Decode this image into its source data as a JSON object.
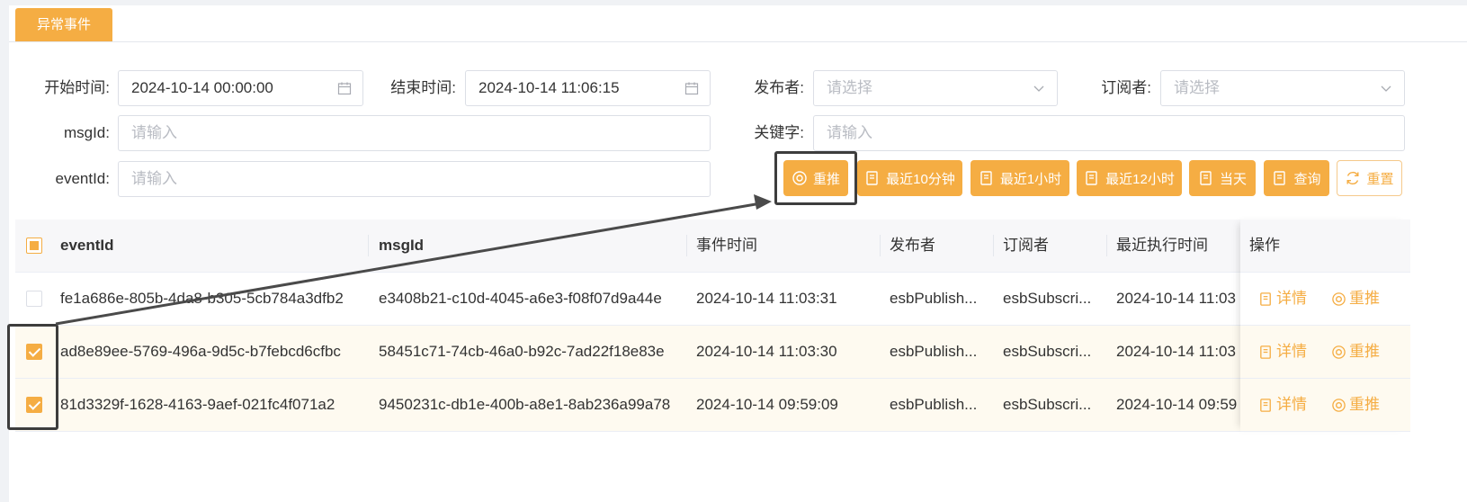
{
  "tab": {
    "label": "异常事件"
  },
  "filters": {
    "start_label": "开始时间:",
    "start_value": "2024-10-14 00:00:00",
    "end_label": "结束时间:",
    "end_value": "2024-10-14 11:06:15",
    "publisher_label": "发布者:",
    "publisher_placeholder": "请选择",
    "subscriber_label": "订阅者:",
    "subscriber_placeholder": "请选择",
    "msgid_label": "msgId:",
    "msgid_placeholder": "请输入",
    "keyword_label": "关键字:",
    "keyword_placeholder": "请输入",
    "eventid_label": "eventId:",
    "eventid_placeholder": "请输入"
  },
  "buttons": {
    "repush": "重推",
    "last10min": "最近10分钟",
    "last1h": "最近1小时",
    "last12h": "最近12小时",
    "today": "当天",
    "query": "查询",
    "reset": "重置"
  },
  "table": {
    "headers": {
      "eventId": "eventId",
      "msgId": "msgId",
      "event_time": "事件时间",
      "publisher": "发布者",
      "subscriber": "订阅者",
      "last_exec": "最近执行时间",
      "ops": "操作"
    },
    "rows": [
      {
        "checked": false,
        "eventId": "fe1a686e-805b-4da8-b305-5cb784a3dfb2",
        "msgId": "e3408b21-c10d-4045-a6e3-f08f07d9a44e",
        "event_time": "2024-10-14 11:03:31",
        "publisher": "esbPublish...",
        "subscriber": "esbSubscri...",
        "last_exec": "2024-10-14 11:03"
      },
      {
        "checked": true,
        "eventId": "ad8e89ee-5769-496a-9d5c-b7febcd6cfbc",
        "msgId": "58451c71-74cb-46a0-b92c-7ad22f18e83e",
        "event_time": "2024-10-14 11:03:30",
        "publisher": "esbPublish...",
        "subscriber": "esbSubscri...",
        "last_exec": "2024-10-14 11:03"
      },
      {
        "checked": true,
        "eventId": "81d3329f-1628-4163-9aef-021fc4f071a2",
        "msgId": "9450231c-db1e-400b-a8e1-8ab236a99a78",
        "event_time": "2024-10-14 09:59:09",
        "publisher": "esbPublish...",
        "subscriber": "esbSubscri...",
        "last_exec": "2024-10-14 09:59"
      }
    ],
    "op_detail": "详情",
    "op_repush": "重推"
  },
  "colors": {
    "accent": "#f5ad43",
    "selected_row": "#fefaf0",
    "annotation": "#3d3d3d"
  }
}
